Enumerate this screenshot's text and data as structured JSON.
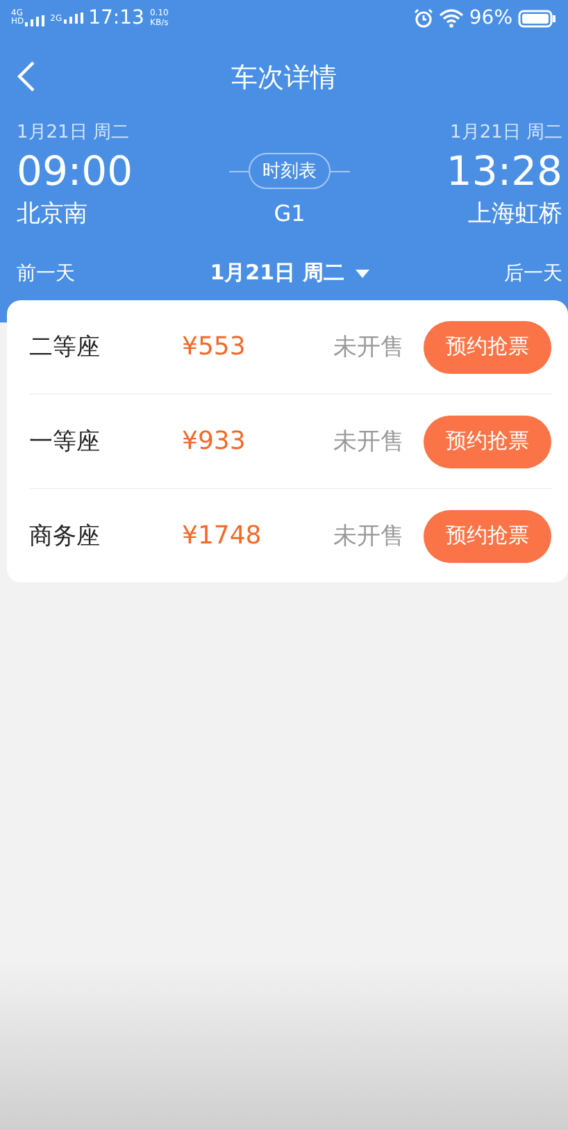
{
  "status_bar": {
    "network_1": "4G",
    "network_1_badge": "HD",
    "network_2": "2G",
    "time": "17:13",
    "speed": "0.10",
    "speed_unit": "KB/s",
    "battery": "96%"
  },
  "header": {
    "title": "车次详情"
  },
  "trip": {
    "depart_date": "1月21日 周二",
    "depart_time": "09:00",
    "depart_station": "北京南",
    "timetable": "时刻表",
    "train_no": "G1",
    "arrive_date": "1月21日 周二",
    "arrive_time": "13:28",
    "arrive_station": "上海虹桥"
  },
  "date_bar": {
    "prev": "前一天",
    "current": "1月21日 周二",
    "next": "后一天"
  },
  "seats": [
    {
      "name": "二等座",
      "price": "¥553",
      "status": "未开售",
      "action": "预约抢票"
    },
    {
      "name": "一等座",
      "price": "¥933",
      "status": "未开售",
      "action": "预约抢票"
    },
    {
      "name": "商务座",
      "price": "¥1748",
      "status": "未开售",
      "action": "预约抢票"
    }
  ]
}
